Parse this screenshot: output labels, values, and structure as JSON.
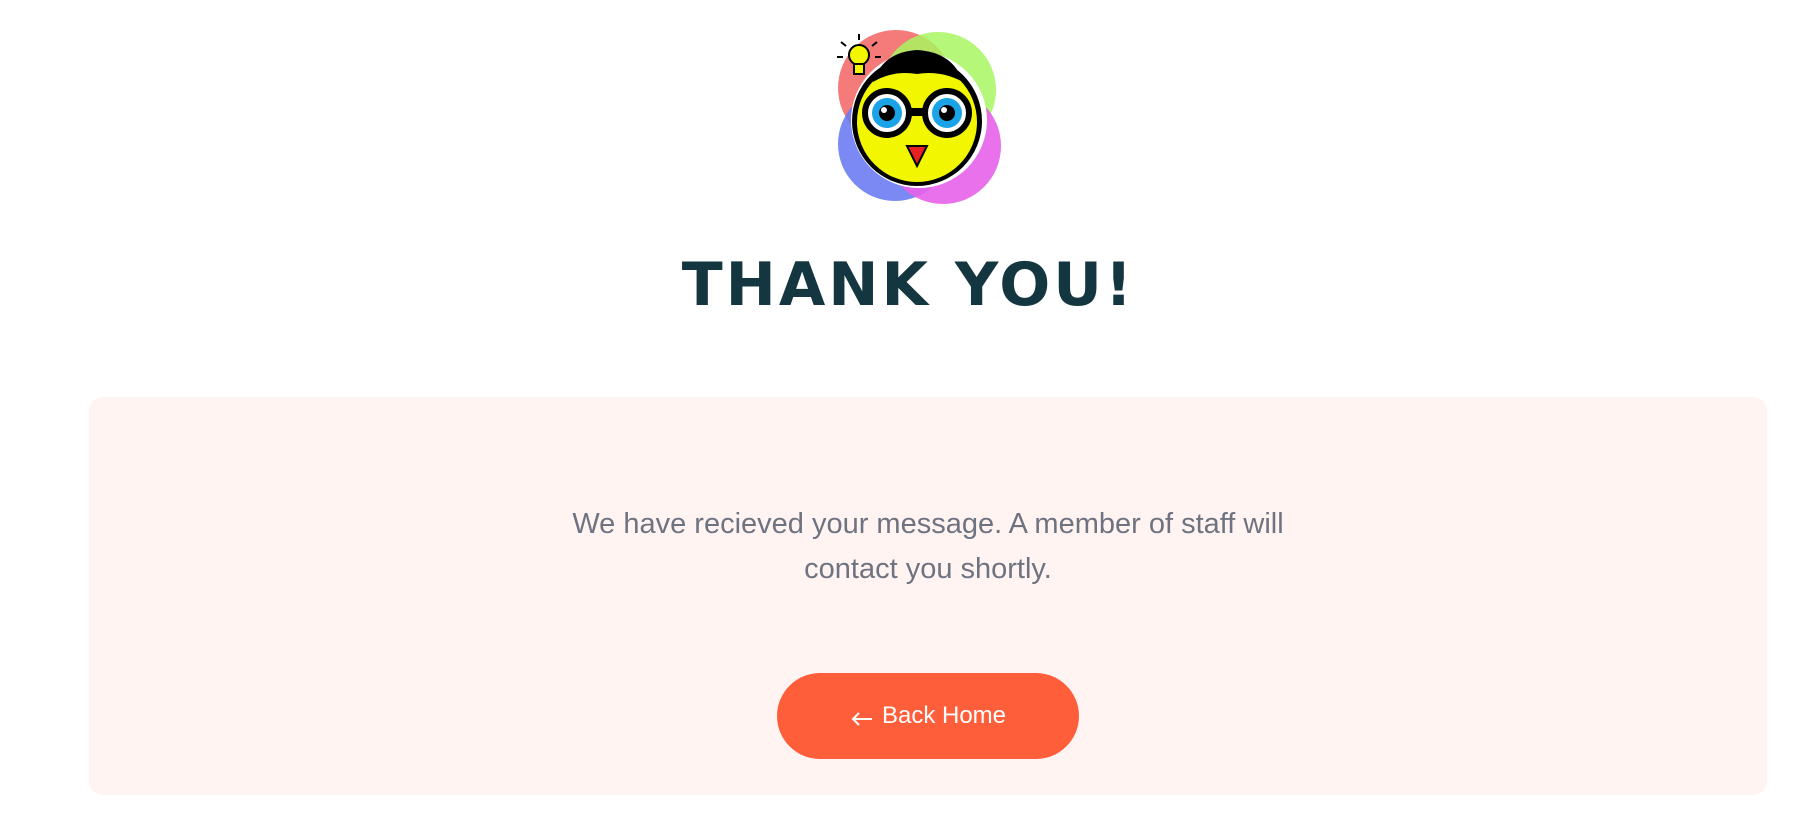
{
  "logo": {
    "icon": "owl-mascot-with-glasses-and-lightbulb-icon"
  },
  "title": "THANK YOU!",
  "card": {
    "message_line1": "We have recieved your message. A member of staff will",
    "message_line2": "contact you shortly.",
    "button": {
      "icon": "arrow-left-icon",
      "label": "Back Home"
    }
  },
  "colors": {
    "title": "#133640",
    "card_background": "#fff4f2",
    "message_text": "#6f7381",
    "button_background": "#ff5e3a",
    "button_text": "#ffffff"
  }
}
